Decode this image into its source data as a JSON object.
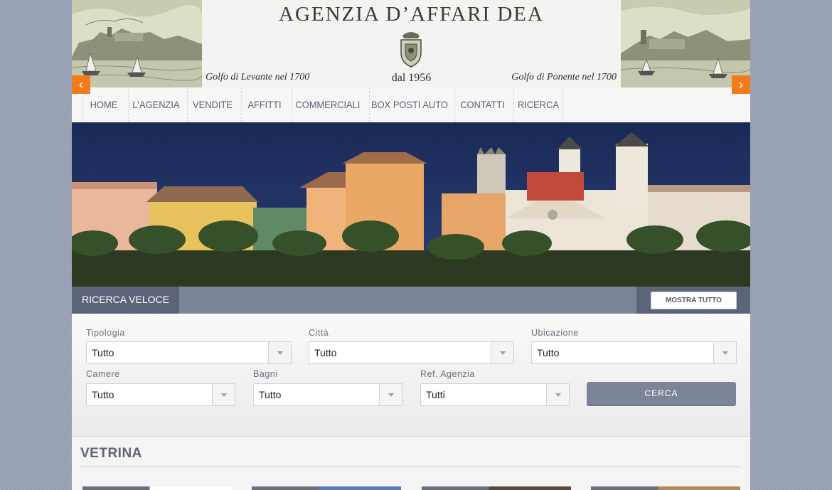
{
  "header": {
    "title": "AGENZIA D’AFFARI DEA",
    "since": "dal 1956",
    "caption_left": "Golfo di Levante nel 1700",
    "caption_right": "Golfo di Ponente nel 1700",
    "crest_icon": "crest-icon"
  },
  "nav": {
    "items": [
      "HOME",
      "L'AGENZIA",
      "VENDITE",
      "AFFITTI",
      "COMMERCIALI",
      "BOX POSTI AUTO",
      "CONTATTI",
      "RICERCA"
    ]
  },
  "slider": {
    "prev_icon": "chevron-left-icon",
    "next_icon": "chevron-right-icon",
    "prev_glyph": "‹",
    "next_glyph": "›"
  },
  "search": {
    "tab_label": "RICERCA VELOCE",
    "show_all_label": "MOSTRA TUTTO",
    "fields": {
      "tipologia": {
        "label": "Tipologia",
        "value": "Tutto"
      },
      "citta": {
        "label": "Città",
        "value": "Tutto"
      },
      "ubicazione": {
        "label": "Ubicazione",
        "value": "Tutto"
      },
      "camere": {
        "label": "Camere",
        "value": "Tutto"
      },
      "bagni": {
        "label": "Bagni",
        "value": "Tutto"
      },
      "ref": {
        "label": "Ref. Agenzia",
        "value": "Tutti"
      }
    },
    "submit_label": "CERCA"
  },
  "showcase": {
    "title": "VETRINA"
  },
  "colors": {
    "accent": "#f07d1a",
    "bar": "#7c8498",
    "bar_dark": "#5c647a",
    "text": "#5e6478"
  }
}
